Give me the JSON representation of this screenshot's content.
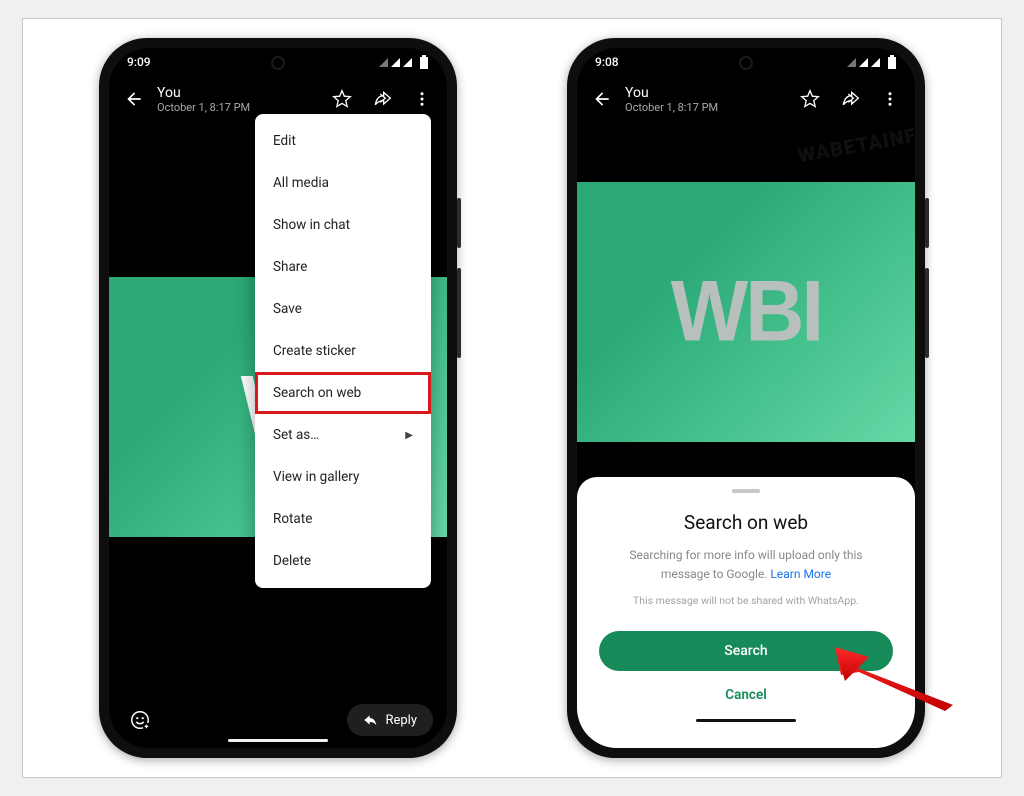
{
  "phone1": {
    "status_time": "9:09",
    "appbar": {
      "name": "You",
      "date": "October 1, 8:17 PM"
    },
    "image_text": "W",
    "reply_label": "Reply",
    "menu": {
      "items": [
        {
          "label": "Edit",
          "highlighted": false
        },
        {
          "label": "All media",
          "highlighted": false
        },
        {
          "label": "Show in chat",
          "highlighted": false
        },
        {
          "label": "Share",
          "highlighted": false
        },
        {
          "label": "Save",
          "highlighted": false
        },
        {
          "label": "Create sticker",
          "highlighted": false
        },
        {
          "label": "Search on web",
          "highlighted": true
        },
        {
          "label": "Set as…",
          "highlighted": false,
          "submenu": true
        },
        {
          "label": "View in gallery",
          "highlighted": false
        },
        {
          "label": "Rotate",
          "highlighted": false
        },
        {
          "label": "Delete",
          "highlighted": false
        }
      ]
    }
  },
  "phone2": {
    "status_time": "9:08",
    "appbar": {
      "name": "You",
      "date": "October 1, 8:17 PM"
    },
    "image_text": "WBI",
    "sheet": {
      "title": "Search on web",
      "desc_1": "Searching for more info will upload only this",
      "desc_2": "message to Google.",
      "learn_more": "Learn More",
      "fine_print": "This message will not be shared with WhatsApp.",
      "search_label": "Search",
      "cancel_label": "Cancel"
    }
  },
  "watermark": "WABETAINFO"
}
